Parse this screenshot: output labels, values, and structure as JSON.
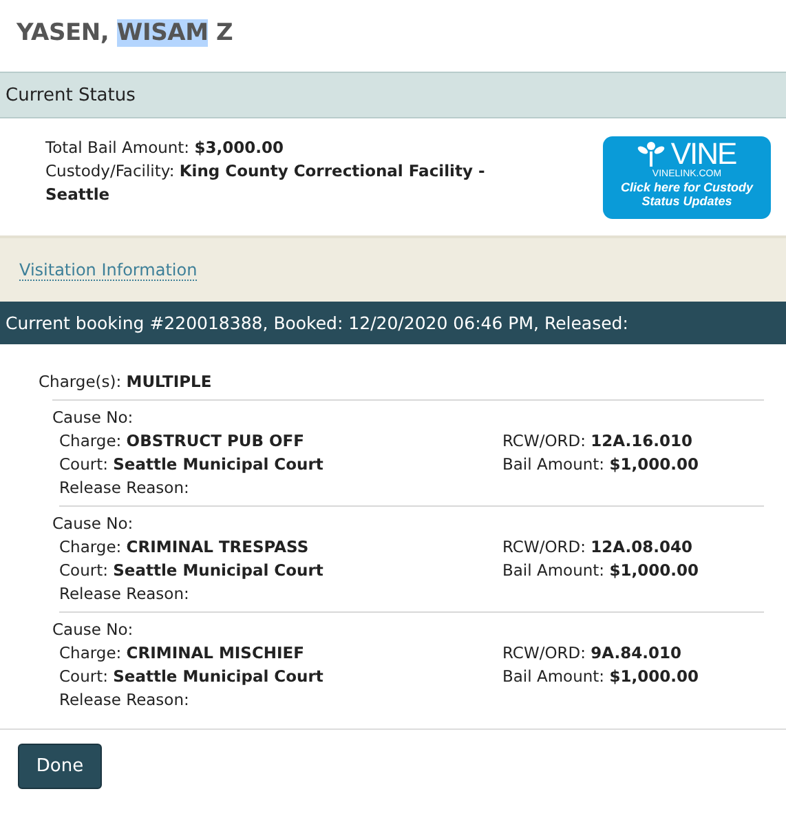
{
  "title": {
    "before": "YASEN, ",
    "selected_text": "WISAM",
    "after": " Z"
  },
  "status": {
    "heading": "Current Status",
    "lines": [
      "Total Bail Amount: **$3,000.00**",
      "Custody/Facility: **King County Correctional Facility - Seattle**"
    ],
    "vine": {
      "logo": "VINE",
      "site": "VINELINK.COM",
      "caption": "Click here for Custody Status Updates"
    }
  },
  "visitation_link": "Visitation Information",
  "booking": {
    "heading": "Current booking #220018388, Booked: 12/20/2020 06:46 PM, Released:",
    "summary": "Charge(s): **MULTIPLE**",
    "charges": [
      {
        "cause": "Cause No:",
        "charge": "Charge: **OBSTRUCT PUB OFF**",
        "court": "Court: **Seattle Municipal Court**",
        "release": "Release Reason:",
        "rcw": "RCW/ORD: **12A.16.010**",
        "bail": "Bail Amount: **$1,000.00**"
      },
      {
        "cause": "Cause No:",
        "charge": "Charge: **CRIMINAL TRESPASS**",
        "court": "Court: **Seattle Municipal Court**",
        "release": "Release Reason:",
        "rcw": "RCW/ORD: **12A.08.040**",
        "bail": "Bail Amount: **$1,000.00**"
      },
      {
        "cause": "Cause No:",
        "charge": "Charge: **CRIMINAL MISCHIEF**",
        "court": "Court: **Seattle Municipal Court**",
        "release": "Release Reason:",
        "rcw": "RCW/ORD: **9A.84.010**",
        "bail": "Bail Amount: **$1,000.00**"
      }
    ]
  },
  "buttons": [
    "Done"
  ]
}
